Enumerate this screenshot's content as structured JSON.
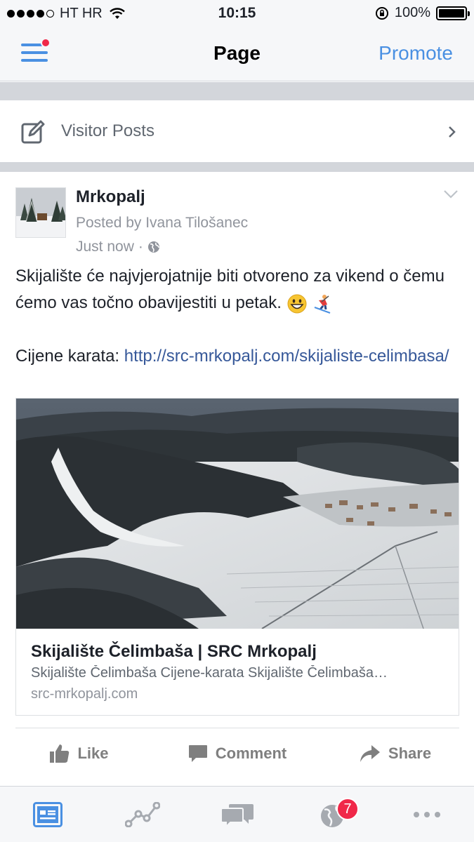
{
  "status_bar": {
    "carrier": "HT HR",
    "time": "10:15",
    "battery": "100%"
  },
  "nav": {
    "title": "Page",
    "promote": "Promote"
  },
  "visitor_posts": {
    "label": "Visitor Posts"
  },
  "post": {
    "author": "Mrkopalj",
    "posted_by": "Posted by Ivana Tilošanec",
    "time": "Just now",
    "separator": "·",
    "text_line1": "Skijalište će najvjerojatnije biti otvoreno za vikend o čemu ćemo vas točno obavijestiti u petak.",
    "price_label": "Cijene karata:",
    "link_url": "http://src-mrkopalj.com/skijaliste-celimbasa/",
    "link_preview": {
      "title": "Skijalište Čelimbaša | SRC Mrkopalj",
      "description": "Skijalište Čelimbaša Cijene-karata Skijalište Čelimbaša…",
      "domain": "src-mrkopalj.com"
    },
    "actions": {
      "like": "Like",
      "comment": "Comment",
      "share": "Share"
    }
  },
  "tab_bar": {
    "notifications_badge": "7"
  },
  "colors": {
    "accent": "#4a90e2",
    "link": "#365899",
    "badge": "#f02849"
  }
}
